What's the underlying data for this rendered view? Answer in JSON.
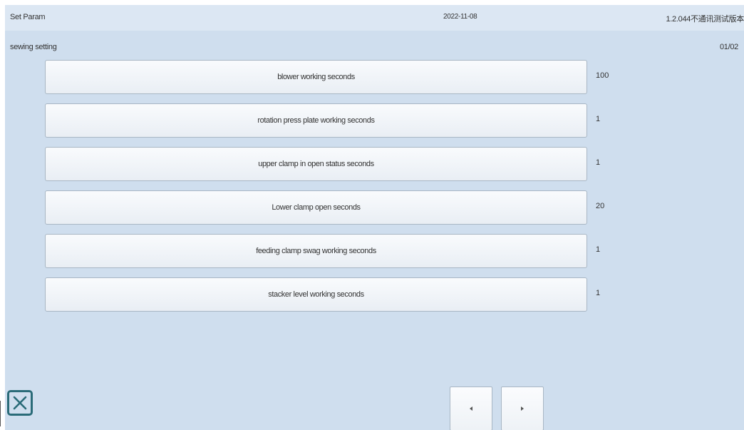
{
  "header": {
    "title": "Set Param",
    "date": "2022-11-08",
    "version": "1.2.044不通讯测试版本"
  },
  "section": {
    "label": "sewing setting",
    "page_indicator": "01/02"
  },
  "params": [
    {
      "label": "blower working seconds",
      "value": "100"
    },
    {
      "label": "rotation press plate working seconds",
      "value": "1"
    },
    {
      "label": "upper clamp in open status seconds",
      "value": "1"
    },
    {
      "label": "Lower clamp open seconds",
      "value": "20"
    },
    {
      "label": "feeding clamp swag working seconds",
      "value": "1"
    },
    {
      "label": "stacker level working seconds",
      "value": "1"
    }
  ],
  "icons": {
    "close": "close-icon",
    "prev": "triangle-left-icon",
    "next": "triangle-right-icon"
  },
  "colors": {
    "background": "#cfdeee",
    "title_bar": "#dce7f3",
    "button_face": "#f4f7fa",
    "button_border": "#a8b6c4",
    "close_icon": "#2a6b78"
  }
}
